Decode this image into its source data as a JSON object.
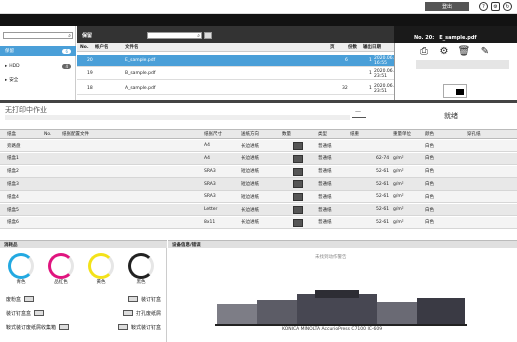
{
  "topbar": {
    "logout": "登出"
  },
  "tabs": [
    "作业管理",
    "配置"
  ],
  "sidebar": {
    "items": [
      {
        "label": "保留",
        "count": "6",
        "selected": true
      },
      {
        "label": "HDD",
        "count": "4"
      },
      {
        "label": "安全",
        "count": ""
      }
    ]
  },
  "folder": {
    "title": "保留",
    "columns": [
      "No.",
      "帐户名",
      "文件名",
      "页",
      "份数",
      "输出日期"
    ],
    "rows": [
      {
        "no": "20",
        "account": "",
        "file": "E_sample.pdf",
        "pages": "6",
        "copies": "1",
        "date": "2020.06.23 16:55"
      },
      {
        "no": "19",
        "account": "",
        "file": "B_sample.pdf",
        "pages": "",
        "copies": "1",
        "date": "2020.06.18 23:51"
      },
      {
        "no": "18",
        "account": "",
        "file": "A_sample.pdf",
        "pages": "32",
        "copies": "1",
        "date": "2020.06.18 23:51"
      }
    ]
  },
  "detail": {
    "title": "No. 20:",
    "file": "E_sample.pdf"
  },
  "status": {
    "message": "无打印中作业",
    "state": "就绪",
    "dash": "—"
  },
  "trays": {
    "columns": [
      "纸盒",
      "No.",
      "纸张配置文件",
      "纸张尺寸",
      "送纸方向",
      "数量",
      "类型",
      "纸重",
      "重量单位",
      "颜色",
      "穿孔纸"
    ],
    "rows": [
      {
        "tray": "旁路盘",
        "size": "A4",
        "dir": "长边进纸",
        "type": "普通纸",
        "weight": "",
        "unit": "",
        "color": "白色"
      },
      {
        "tray": "纸盒1",
        "size": "A4",
        "dir": "长边进纸",
        "type": "普通纸",
        "weight": "62-74",
        "unit": "g/m²",
        "color": "白色"
      },
      {
        "tray": "纸盒2",
        "size": "SRA3",
        "dir": "短边进纸",
        "type": "普通纸",
        "weight": "52-61",
        "unit": "g/m²",
        "color": "白色"
      },
      {
        "tray": "纸盒3",
        "size": "SRA3",
        "dir": "短边进纸",
        "type": "普通纸",
        "weight": "52-61",
        "unit": "g/m²",
        "color": "白色"
      },
      {
        "tray": "纸盒4",
        "size": "SRA3",
        "dir": "短边进纸",
        "type": "普通纸",
        "weight": "52-61",
        "unit": "g/m²",
        "color": "白色"
      },
      {
        "tray": "纸盒5",
        "size": "Letter",
        "dir": "长边进纸",
        "type": "普通纸",
        "weight": "52-61",
        "unit": "g/m²",
        "color": "白色"
      },
      {
        "tray": "纸盒6",
        "size": "8x11",
        "dir": "长边进纸",
        "type": "普通纸",
        "weight": "52-61",
        "unit": "g/m²",
        "color": "白色"
      }
    ]
  },
  "consumables": {
    "title": "消耗品",
    "toners": [
      {
        "label": "青色",
        "color": "#23a9e1"
      },
      {
        "label": "品红色",
        "color": "#e0157f"
      },
      {
        "label": "黄色",
        "color": "#f3e21a"
      },
      {
        "label": "黑色",
        "color": "#222222"
      }
    ],
    "items": [
      {
        "left": "废粉盒",
        "right": "装订钉盒"
      },
      {
        "left": "装订钉盒盒",
        "right": "打孔废纸屑"
      },
      {
        "left": "鞍式装订废纸屑收集箱",
        "right": "鞍式装订钉盒"
      }
    ]
  },
  "device": {
    "title": "设备信息/错误",
    "message": "未找到动作警告",
    "name": "KONICA MINOLTA AccurioPress C7100 IC-609"
  }
}
